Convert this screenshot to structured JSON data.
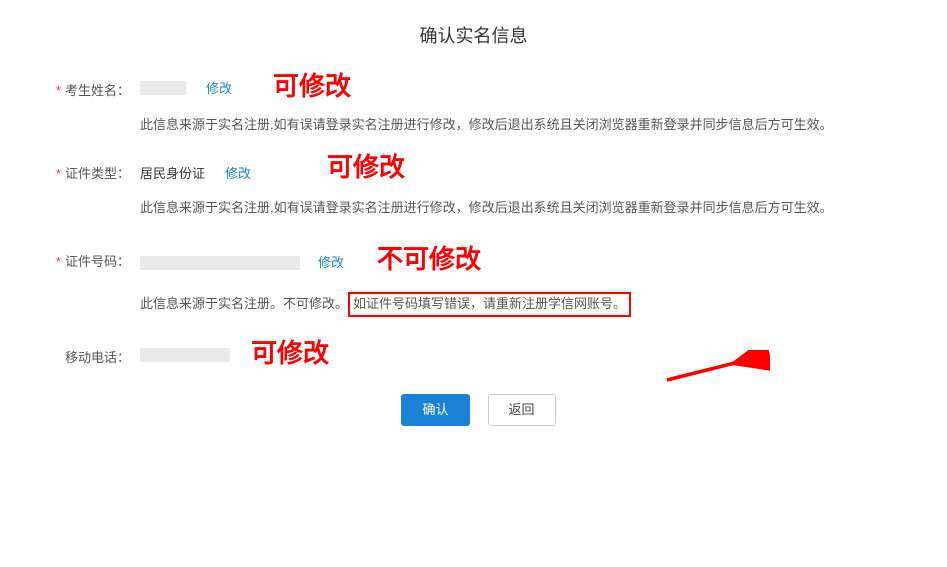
{
  "title": "确认实名信息",
  "fields": {
    "name": {
      "label": "考生姓名：",
      "edit_link": "修改",
      "hint": "此信息来源于实名注册,如有误请登录实名注册进行修改，修改后退出系统且关闭浏览器重新登录并同步信息后方可生效。",
      "annotation": "可修改"
    },
    "id_type": {
      "label": "证件类型：",
      "value": "居民身份证",
      "edit_link": "修改",
      "hint": "此信息来源于实名注册,如有误请登录实名注册进行修改，修改后退出系统且关闭浏览器重新登录并同步信息后方可生效。",
      "annotation": "可修改"
    },
    "id_number": {
      "label": "证件号码：",
      "edit_link": "修改",
      "hint_prefix": "此信息来源于实名注册。不可修改。",
      "hint_boxed": "如证件号码填写错误，请重新注册学信网账号。",
      "annotation": "不可修改"
    },
    "phone": {
      "label": "移动电话：",
      "annotation": "可修改"
    }
  },
  "buttons": {
    "confirm": "确认",
    "back": "返回"
  }
}
